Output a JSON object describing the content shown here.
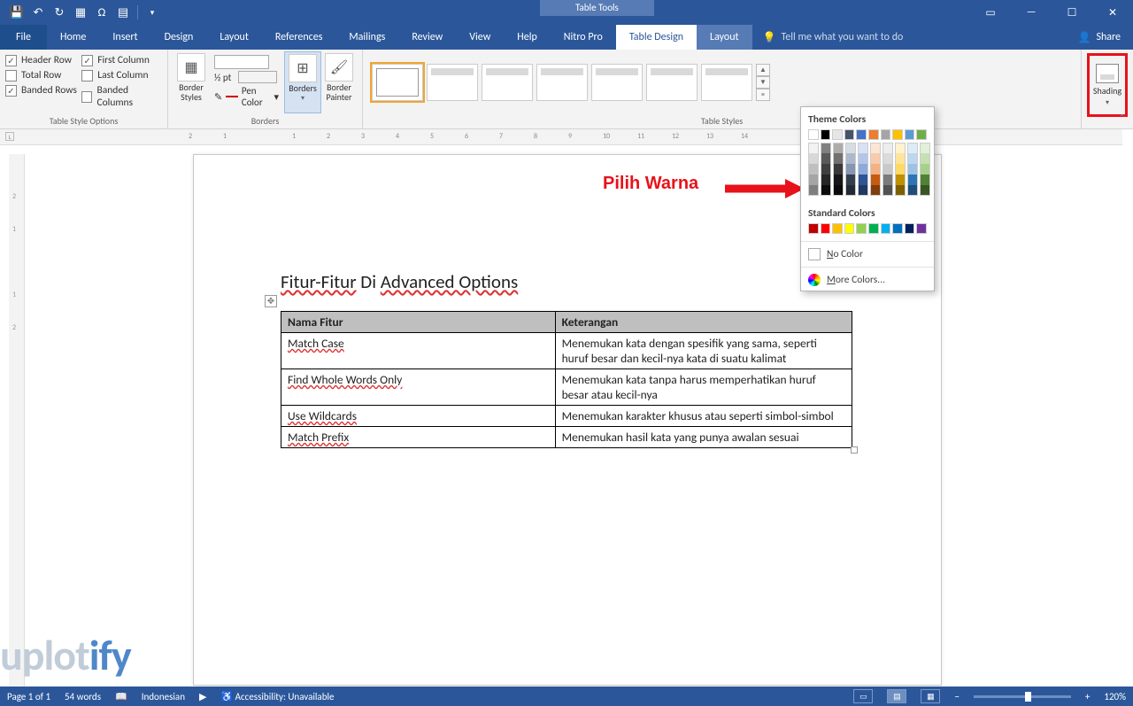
{
  "titlebar": {
    "context_tab": "Table Tools"
  },
  "qat_icons": [
    "save",
    "undo",
    "redo",
    "touch",
    "omega",
    "page",
    "down"
  ],
  "window_controls": {
    "ribbon": "▭",
    "min": "—",
    "max": "☐",
    "close": "✕"
  },
  "tabs": {
    "file": "File",
    "home": "Home",
    "insert": "Insert",
    "design": "Design",
    "layout": "Layout",
    "references": "References",
    "mailings": "Mailings",
    "review": "Review",
    "view": "View",
    "help": "Help",
    "nitro": "Nitro Pro",
    "table_design": "Table Design",
    "table_layout": "Layout"
  },
  "tell_me": "Tell me what you want to do",
  "share": "Share",
  "ribbon": {
    "style_options": {
      "label": "Table Style Options",
      "header_row": "Header Row",
      "first_col": "First Column",
      "total_row": "Total Row",
      "last_col": "Last Column",
      "banded_rows": "Banded Rows",
      "banded_cols": "Banded Columns"
    },
    "borders": {
      "label": "Borders",
      "border_styles": "Border\nStyles",
      "line_weight": "½ pt",
      "pen_color": "Pen Color",
      "borders_btn": "Borders",
      "border_painter": "Border\nPainter"
    },
    "table_styles": {
      "label": "Table Styles"
    },
    "shading": {
      "label": "Shading"
    }
  },
  "color_panel": {
    "theme_label": "Theme Colors",
    "standard_label": "Standard Colors",
    "no_color": "No Color",
    "more_colors": "More Colors...",
    "theme_top": [
      "#ffffff",
      "#000000",
      "#e7e6e6",
      "#44546a",
      "#4472c4",
      "#ed7d31",
      "#a5a5a5",
      "#ffc000",
      "#5b9bd5",
      "#70ad47"
    ],
    "theme_shades": [
      [
        "#f2f2f2",
        "#808080",
        "#aeabab",
        "#d6dce4",
        "#d9e2f3",
        "#fbe5d5",
        "#ededed",
        "#fff2cc",
        "#deebf6",
        "#e2efd9"
      ],
      [
        "#d8d8d8",
        "#595959",
        "#757070",
        "#adb9ca",
        "#b4c6e7",
        "#f7cbac",
        "#dbdbdb",
        "#fee599",
        "#bdd7ee",
        "#c5e0b3"
      ],
      [
        "#bfbfbf",
        "#3f3f3f",
        "#3a3838",
        "#8496b0",
        "#8eaadb",
        "#f4b183",
        "#c9c9c9",
        "#ffd965",
        "#9cc3e5",
        "#a8d08d"
      ],
      [
        "#a5a5a5",
        "#262626",
        "#171616",
        "#323f4f",
        "#2f5496",
        "#c55a11",
        "#7b7b7b",
        "#bf9000",
        "#2e75b5",
        "#538135"
      ],
      [
        "#7f7f7f",
        "#0c0c0c",
        "#0a0a0a",
        "#222a35",
        "#1f3864",
        "#833c0b",
        "#525252",
        "#7f6000",
        "#1e4e79",
        "#375623"
      ]
    ],
    "standard": [
      "#c00000",
      "#ff0000",
      "#ffc000",
      "#ffff00",
      "#92d050",
      "#00b050",
      "#00b0f0",
      "#0070c0",
      "#002060",
      "#7030a0"
    ]
  },
  "ruler_h": [
    "2",
    "1",
    "",
    "1",
    "2",
    "3",
    "4",
    "5",
    "6",
    "7",
    "8",
    "9",
    "10",
    "11",
    "12",
    "13",
    "14"
  ],
  "ruler_v": [
    "",
    "2",
    "1",
    "",
    "1",
    "2",
    "",
    "",
    "",
    "",
    "",
    "",
    ""
  ],
  "document": {
    "title_pre": "Fitur-Fitur",
    "title_mid": " Di ",
    "title_post": "Advanced Options",
    "col1": "Nama Fitur",
    "col2": "Keterangan",
    "rows": [
      {
        "f": "Match Case",
        "k": "Menemukan kata dengan spesifik yang sama, seperti huruf besar dan kecil-nya kata di suatu kalimat"
      },
      {
        "f": "Find Whole Words Only",
        "k": "Menemukan kata tanpa harus memperhatikan huruf besar atau kecil-nya"
      },
      {
        "f": "Use Wildcards",
        "k": "Menemukan karakter khusus atau seperti simbol-simbol"
      },
      {
        "f": "Match Prefix",
        "k": "Menemukan hasil kata yang punya awalan sesuai"
      }
    ]
  },
  "annotation": "Pilih Warna",
  "status": {
    "page": "Page 1 of 1",
    "words": "54 words",
    "lang": "Indonesian",
    "accessibility": "Accessibility: Unavailable",
    "zoom": "120%"
  },
  "watermark": {
    "a": "uplot",
    "b": "ify"
  }
}
